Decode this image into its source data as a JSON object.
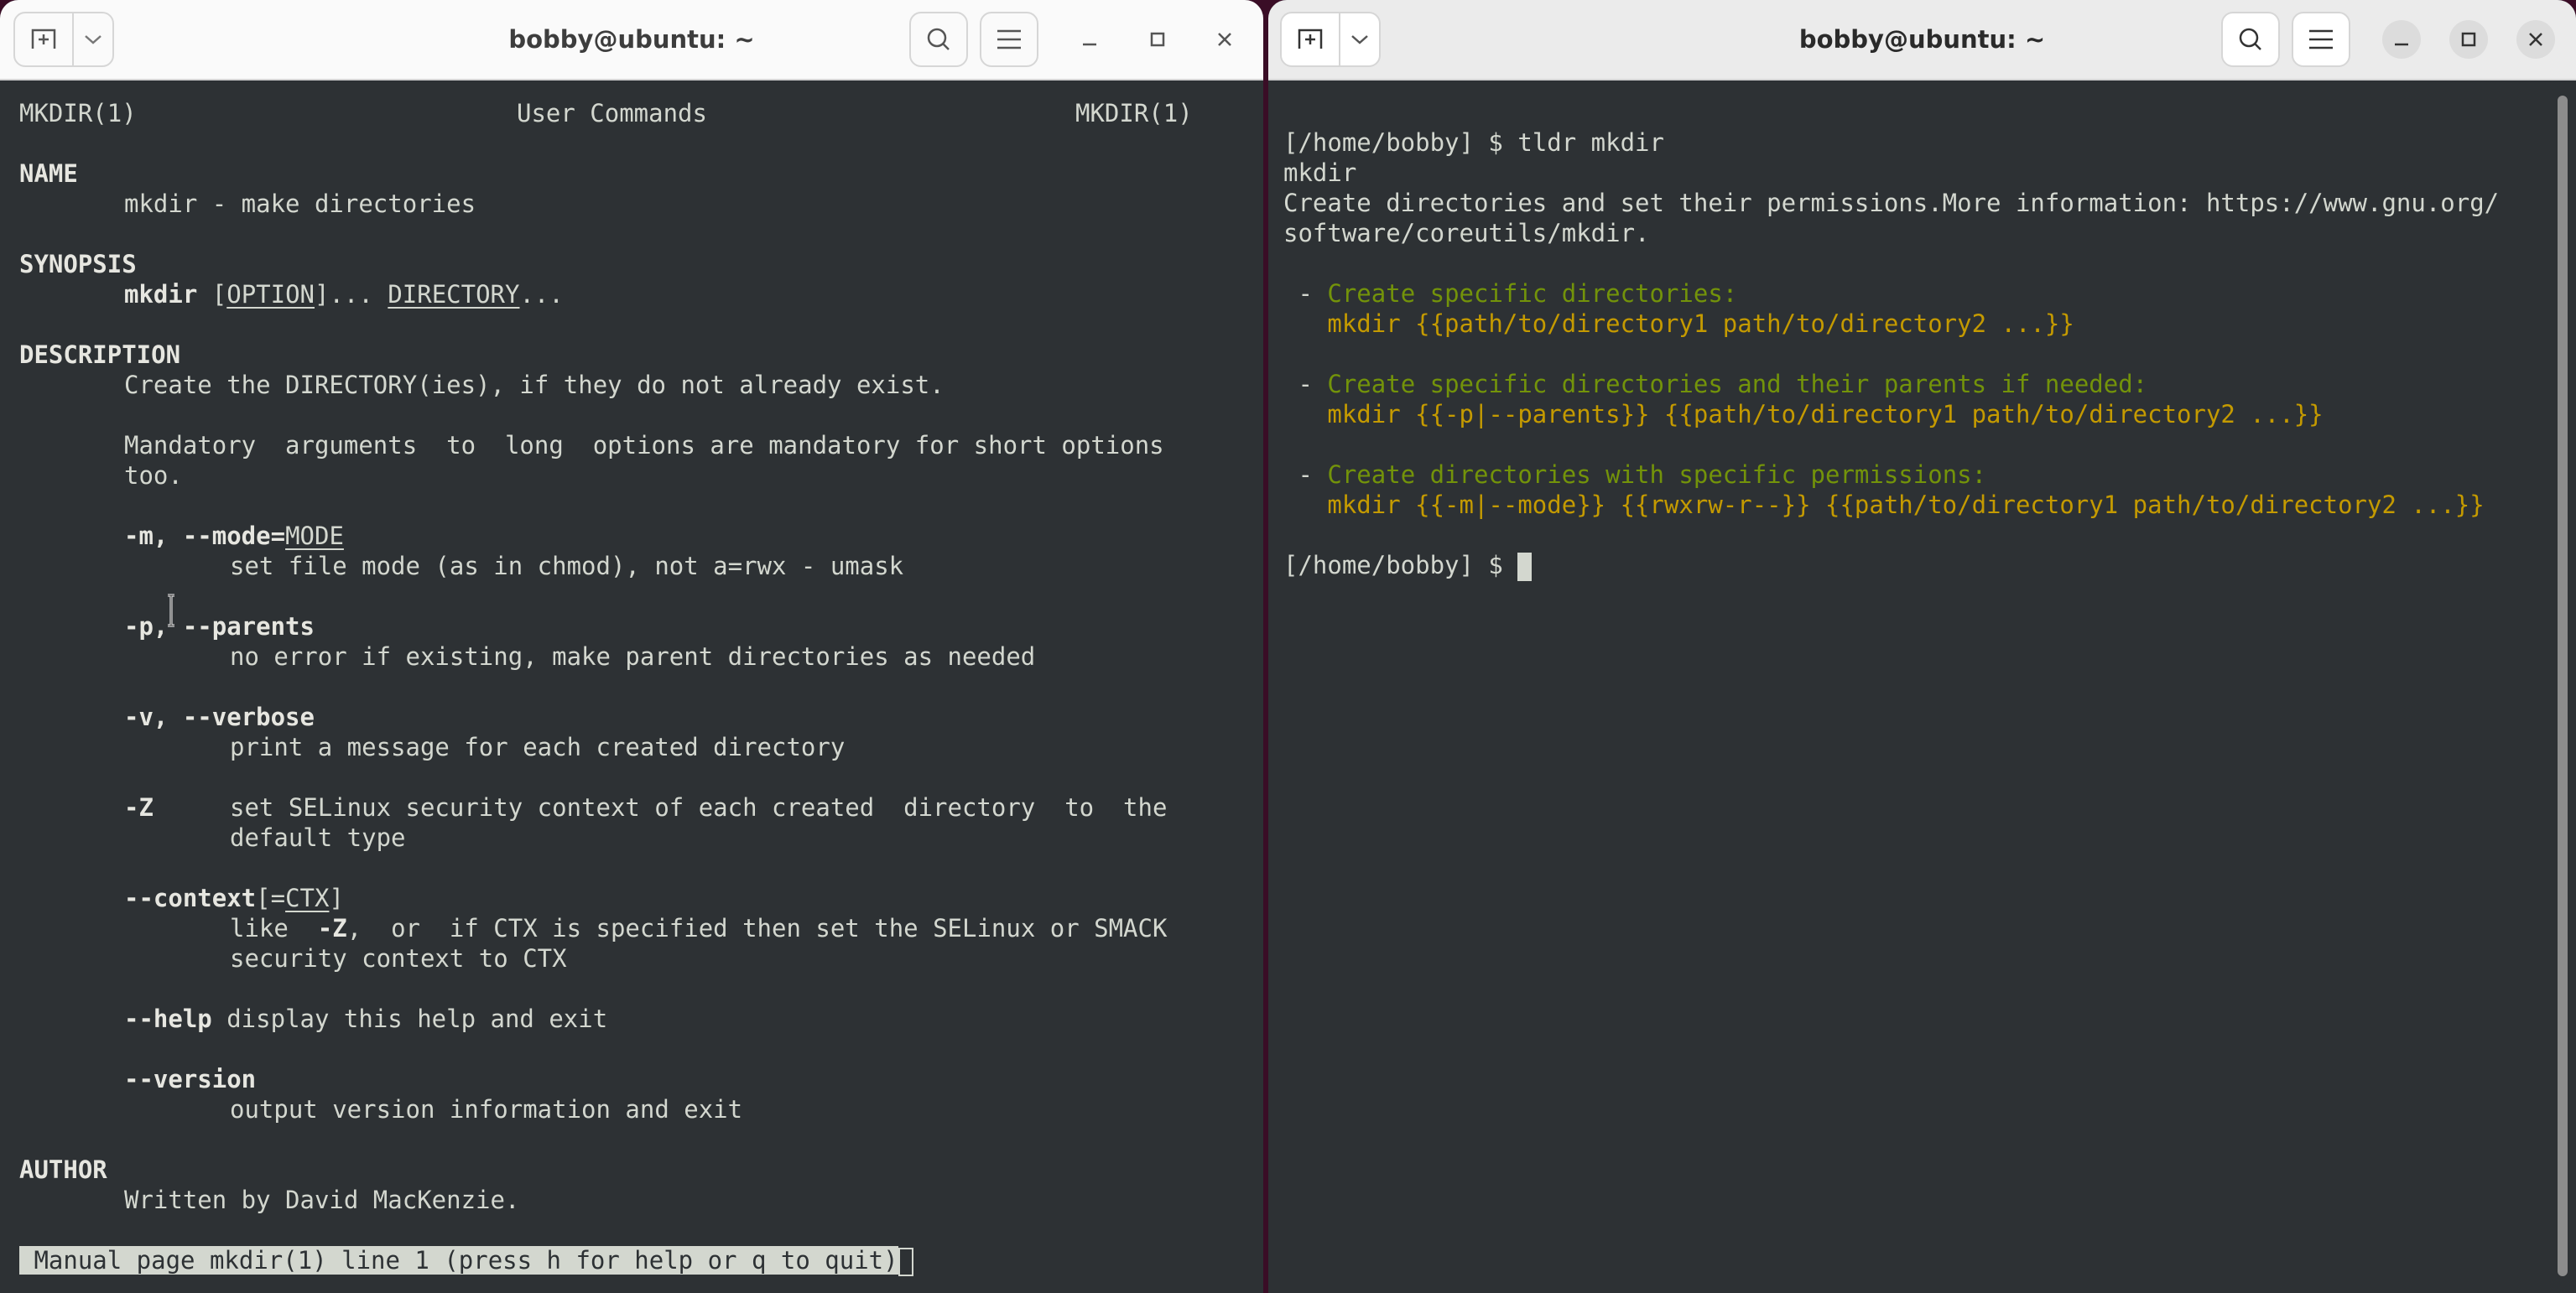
{
  "windows": [
    {
      "title": "bobby@ubuntu: ~",
      "buttons": {
        "new_tab": "new-tab-icon",
        "dropdown": "chevron-down-icon",
        "search": "search-icon",
        "menu": "hamburger-menu-icon",
        "minimize": "minimize-icon",
        "maximize": "maximize-icon",
        "close": "close-icon"
      },
      "man_page": {
        "header_left": "MKDIR(1)",
        "header_center": "User Commands",
        "header_right": "MKDIR(1)",
        "sections": {
          "name_heading": "NAME",
          "name_text": "mkdir - make directories",
          "synopsis_heading": "SYNOPSIS",
          "synopsis_cmd": "mkdir",
          "synopsis_open": "[",
          "synopsis_option": "OPTION",
          "synopsis_close": "]...",
          "synopsis_directory": "DIRECTORY",
          "synopsis_tail": "...",
          "description_heading": "DESCRIPTION",
          "description_line1": "Create the DIRECTORY(ies), if they do not already exist.",
          "description_line2": "Mandatory  arguments  to  long  options are mandatory for short options",
          "description_line3": "too.",
          "opt_mode_flag": "-m, --mode=",
          "opt_mode_arg": "MODE",
          "opt_mode_desc": "set file mode (as in chmod), not a=rwx - umask",
          "opt_parents_flag": "-p, --parents",
          "opt_parents_desc": "no error if existing, make parent directories as needed",
          "opt_verbose_flag": "-v, --verbose",
          "opt_verbose_desc": "print a message for each created directory",
          "opt_z_flag": "-Z",
          "opt_z_desc1": "set SELinux security context of each created  directory  to  the",
          "opt_z_desc2": "default type",
          "opt_context_flag": "--context",
          "opt_context_open": "[=",
          "opt_context_arg": "CTX",
          "opt_context_close": "]",
          "opt_context_desc1_a": "like  ",
          "opt_context_desc1_flag": "-Z",
          "opt_context_desc1_b": ",  or  if CTX is specified then set the SELinux or SMACK",
          "opt_context_desc2": "security context to CTX",
          "opt_help_flag": "--help",
          "opt_help_desc": " display this help and exit",
          "opt_version_flag": "--version",
          "opt_version_desc": "output version information and exit",
          "author_heading": "AUTHOR",
          "author_text": "Written by David MacKenzie."
        },
        "status_line": " Manual page mkdir(1) line 1 (press h for help or q to quit)"
      }
    },
    {
      "title": "bobby@ubuntu: ~",
      "buttons": {
        "new_tab": "new-tab-icon",
        "dropdown": "chevron-down-icon",
        "search": "search-icon",
        "menu": "hamburger-menu-icon",
        "minimize": "minimize-icon",
        "maximize": "maximize-icon",
        "close": "close-icon"
      },
      "terminal": {
        "prompt": "[/home/bobby] $ ",
        "command": "tldr mkdir",
        "page_title": "mkdir",
        "description_line1": "Create directories and set their permissions.More information: https://www.gnu.org/",
        "description_line2": "software/coreutils/mkdir.",
        "examples": [
          {
            "bullet": " - ",
            "description": "Create specific directories:",
            "command": "   mkdir {{path/to/directory1 path/to/directory2 ...}}"
          },
          {
            "bullet": " - ",
            "description": "Create specific directories and their parents if needed:",
            "command": "   mkdir {{-p|--parents}} {{path/to/directory1 path/to/directory2 ...}}"
          },
          {
            "bullet": " - ",
            "description": "Create directories with specific permissions:",
            "command": "   mkdir {{-m|--mode}} {{rwxrw-r--}} {{path/to/directory1 path/to/directory2 ...}}"
          }
        ],
        "final_prompt": "[/home/bobby] $ "
      }
    }
  ],
  "colors": {
    "terminal_bg": "#2d3134",
    "terminal_fg": "#d3d7cf",
    "tldr_description": "#73930a",
    "tldr_command": "#c49a00",
    "desktop_bg": "#3a0d26"
  }
}
